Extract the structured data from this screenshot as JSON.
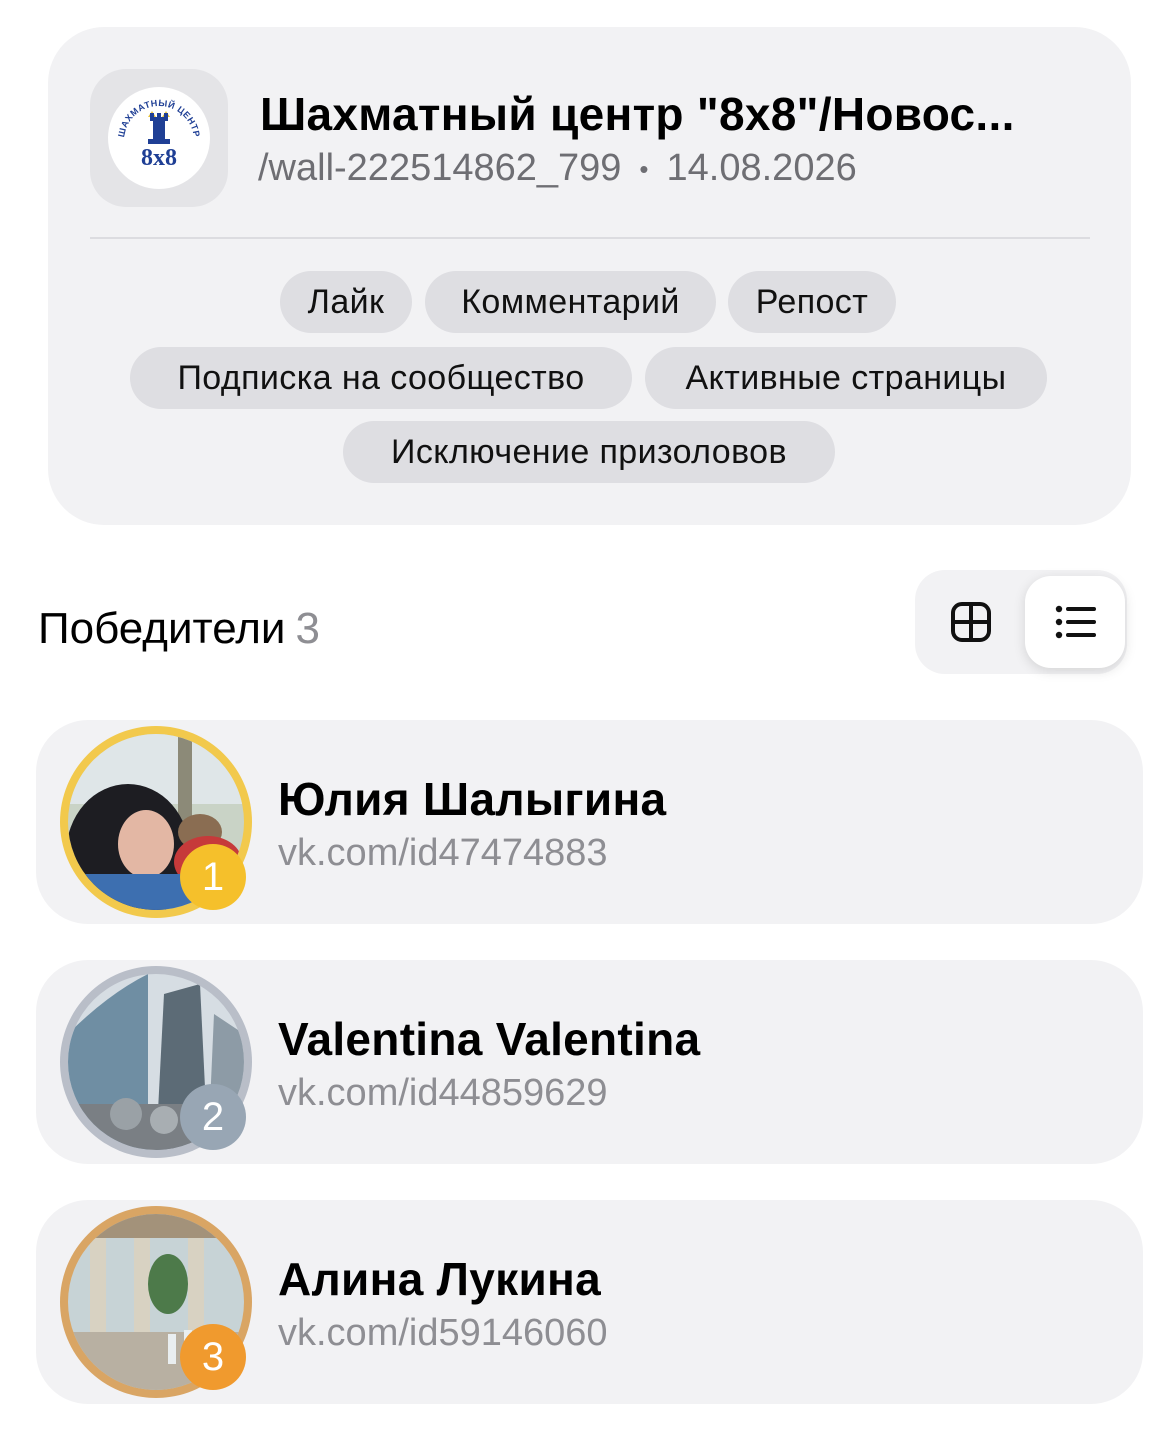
{
  "post": {
    "title": "Шахматный центр \"8x8\"/Новос...",
    "path": "/wall-222514862_799",
    "separator": "•",
    "date": "14.08.2026",
    "logo": {
      "top_text": "ШАХМАТНЫЙ ЦЕНТР",
      "number_text": "8х8",
      "icon": "rook-icon"
    },
    "conditions": [
      "Лайк",
      "Комментарий",
      "Репост",
      "Подписка на сообщество",
      "Активные страницы",
      "Исключение призоловов"
    ]
  },
  "winners_section": {
    "title": "Победители",
    "count": "3",
    "view_modes": [
      {
        "icon": "grid-icon",
        "selected": false
      },
      {
        "icon": "list-icon",
        "selected": true
      }
    ]
  },
  "winners": [
    {
      "place": "1",
      "name": "Юлия Шалыгина",
      "link": "vk.com/id47474883",
      "ring_color": "#f2c94c",
      "badge_color": "#f5c02b"
    },
    {
      "place": "2",
      "name": "Valentina Valentina",
      "link": "vk.com/id44859629",
      "ring_color": "#b9bec8",
      "badge_color": "#98a6b4"
    },
    {
      "place": "3",
      "name": "Алина Лукина",
      "link": "vk.com/id59146060",
      "ring_color": "#d9a564",
      "badge_color": "#f09a2e"
    }
  ],
  "colors": {
    "card_bg": "#f2f2f4",
    "chip_bg": "#dedee2",
    "secondary_text": "#8e8e93",
    "logo_blue": "#1f3f95"
  }
}
